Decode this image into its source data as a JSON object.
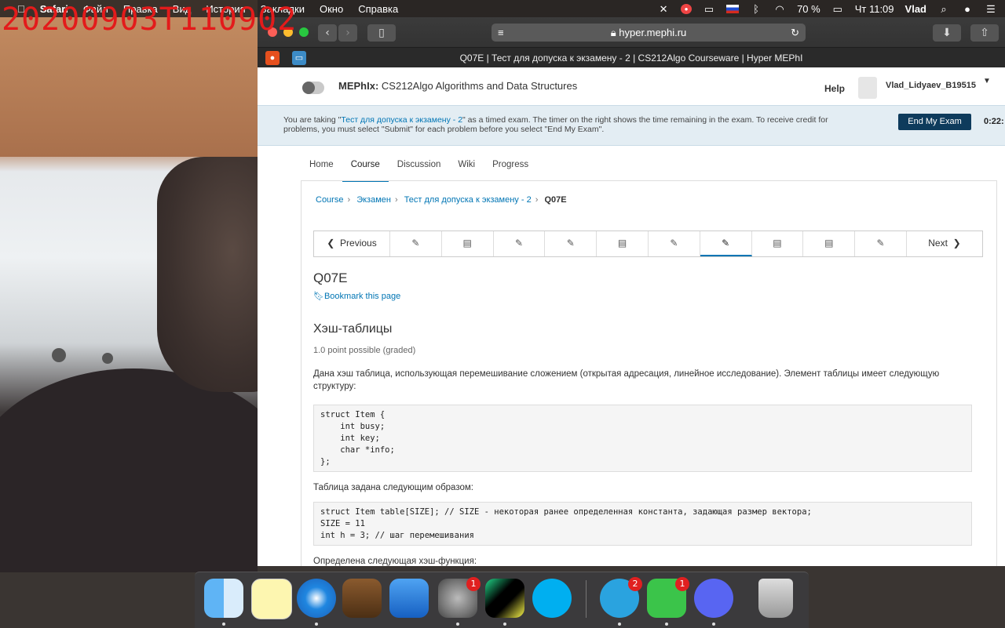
{
  "overlay": {
    "timestamp": "20200903T110902"
  },
  "menubar": {
    "app": "Safari",
    "items": [
      "Файл",
      "Правка",
      "Вид",
      "История",
      "Закладки",
      "Окно",
      "Справка"
    ],
    "battery": "70 %",
    "clock": "Чт 11:09",
    "user": "Vlad"
  },
  "browser": {
    "url": "hyper.mephi.ru",
    "tab_title": "Q07E | Тест для допуска к экзамену - 2 | CS212Algo Courseware | Hyper MEPhI"
  },
  "header": {
    "org": "MEPhIx:",
    "course": "CS212Algo Algorithms and Data Structures",
    "help": "Help",
    "username": "Vlad_Lidyaev_B19515"
  },
  "banner": {
    "text_before": "You are taking \"",
    "exam_link": "Тест для допуска к экзамену - 2",
    "text_after": "\" as a timed exam. The timer on the right shows the time remaining in the exam. To receive credit for problems, you must select \"Submit\" for each problem before you select \"End My Exam\".",
    "end_button": "End My Exam",
    "timer": "0:22:"
  },
  "tabs": [
    "Home",
    "Course",
    "Discussion",
    "Wiki",
    "Progress"
  ],
  "breadcrumb": {
    "c1": "Course",
    "c2": "Экзамен",
    "c3": "Тест для допуска к экзамену - 2",
    "current": "Q07E"
  },
  "sequence": {
    "previous": "Previous",
    "next": "Next"
  },
  "unit": {
    "title": "Q07E",
    "bookmark": "Bookmark this page",
    "problem_title": "Хэш-таблицы",
    "points": "1.0 point possible (graded)",
    "p1": "Дана хэш таблица, использующая перемешивание сложением (открытая адресация, линейное исследование). Элемент таблицы имеет следующую структуру:",
    "code1": "struct Item {\n    int busy;\n    int key;\n    char *info;\n};",
    "p2": "Таблица задана следующим образом:",
    "code2": "struct Item table[SIZE]; // SIZE - некоторая ранее определенная константа, задающая размер вектора;\nSIZE = 11\nint h = 3; // шаг перемешивания",
    "p3": "Определена следующая хэш-функция:"
  },
  "dock": {
    "badges": {
      "system_prefs": "1",
      "telegram": "2",
      "facetime": "1"
    }
  }
}
